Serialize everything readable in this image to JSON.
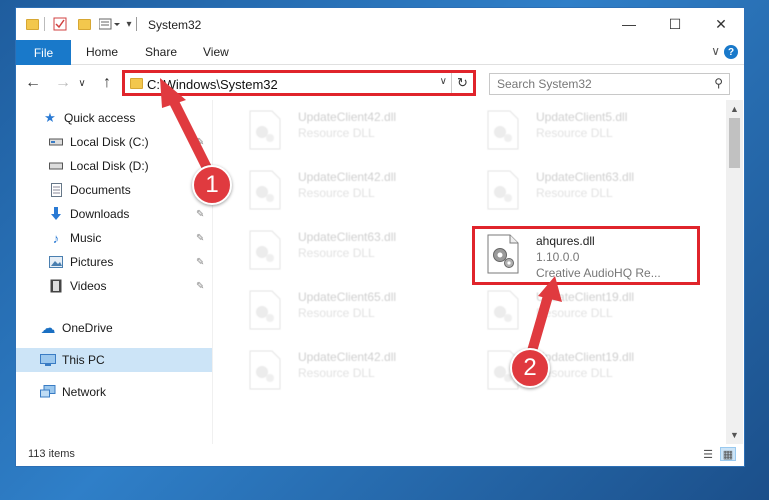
{
  "window": {
    "title": "System32",
    "minimize_glyph": "—",
    "maximize_glyph": "☐",
    "close_glyph": "✕"
  },
  "ribbon": {
    "tabs": [
      "File",
      "Home",
      "Share",
      "View"
    ],
    "collapse_glyph": "∨",
    "help_glyph": "?"
  },
  "navigation": {
    "back_glyph": "←",
    "forward_glyph": "→",
    "recent_glyph": "∨",
    "up_glyph": "↑",
    "address_path": "C:\\Windows\\System32",
    "address_dropdown_glyph": "∨",
    "refresh_glyph": "↻",
    "search_placeholder": "Search System32",
    "search_glyph": "⚲"
  },
  "sidebar": {
    "items": [
      {
        "label": "Quick access",
        "icon": "star-icon",
        "glyph": "★",
        "color": "#2a7ad4"
      },
      {
        "label": "Local Disk (C:)",
        "icon": "drive-icon",
        "glyph": "▭",
        "color": "#555555",
        "pin": "📌"
      },
      {
        "label": "Local Disk (D:)",
        "icon": "drive-icon",
        "glyph": "▭",
        "color": "#555555"
      },
      {
        "label": "Documents",
        "icon": "documents-icon",
        "glyph": "▤",
        "color": "#667788"
      },
      {
        "label": "Downloads",
        "icon": "downloads-icon",
        "glyph": "⬇",
        "color": "#2a7ad4",
        "pin": "📌"
      },
      {
        "label": "Music",
        "icon": "music-icon",
        "glyph": "♪",
        "color": "#2a7ad4",
        "pin": "📌"
      },
      {
        "label": "Pictures",
        "icon": "pictures-icon",
        "glyph": "▨",
        "color": "#4a7fb0",
        "pin": "📌"
      },
      {
        "label": "Videos",
        "icon": "videos-icon",
        "glyph": "▦",
        "color": "#444444",
        "pin": "📌"
      },
      {
        "label": "OneDrive",
        "icon": "onedrive-icon",
        "glyph": "☁",
        "color": "#1a6fc2"
      },
      {
        "label": "This PC",
        "icon": "this-pc-icon",
        "glyph": "▭",
        "color": "#3a7cc4"
      },
      {
        "label": "Network",
        "icon": "network-icon",
        "glyph": "⧉",
        "color": "#3a7cc4"
      }
    ]
  },
  "files": [
    {
      "name": "UpdateClient42.dll",
      "desc": "Resource DLL"
    },
    {
      "name": "UpdateClient5.dll",
      "desc": "Resource DLL"
    },
    {
      "name": "UpdateClient42.dll",
      "desc": "Resource DLL"
    },
    {
      "name": "UpdateClient63.dll",
      "desc": "Resource DLL"
    },
    {
      "name": "UpdateClient63.dll",
      "desc": "Resource DLL"
    },
    {
      "name": "ahqures.dll",
      "desc": "1.10.0.0",
      "sub": "Creative AudioHQ Re..."
    },
    {
      "name": "UpdateClient65.dll",
      "desc": "Resource DLL"
    },
    {
      "name": "UpdateClient19.dll",
      "desc": "Resource DLL"
    },
    {
      "name": "UpdateClient42.dll",
      "desc": "Resource DLL"
    },
    {
      "name": "UpdateClient19.dll",
      "desc": "Resource DLL"
    }
  ],
  "status": {
    "item_count": "113 items",
    "details_view_glyph": "☰",
    "tiles_view_glyph": "▦"
  },
  "annotations": {
    "step1": "1",
    "step2": "2",
    "highlight_color": "#e0242b"
  }
}
